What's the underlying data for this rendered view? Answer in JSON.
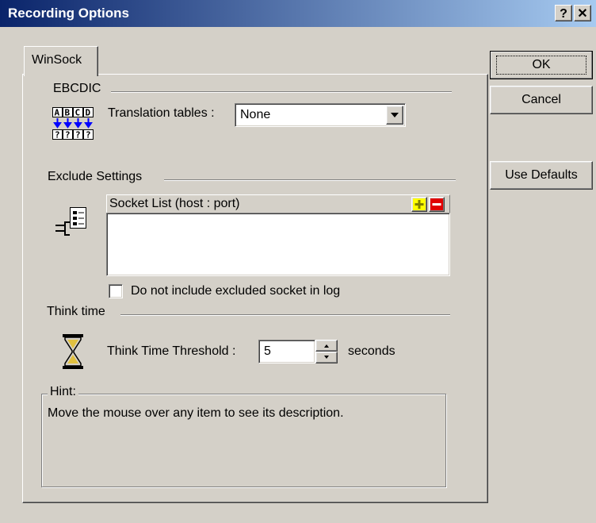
{
  "dialog": {
    "title": "Recording Options",
    "help_button": "?",
    "close_button": "✕"
  },
  "tabs": [
    {
      "label": "WinSock",
      "active": true
    }
  ],
  "buttons": {
    "ok": "OK",
    "cancel": "Cancel",
    "use_defaults": "Use Defaults"
  },
  "ebcdic": {
    "heading": "EBCDIC",
    "icon_top": "ABCD",
    "icon_bottom": "????",
    "translation_label": "Translation tables :",
    "translation_value": "None"
  },
  "exclude": {
    "heading": "Exclude Settings",
    "socket_list_header": "Socket List (host : port)",
    "add_glyph": "+",
    "remove_glyph": "−",
    "socket_items": [],
    "checkbox_label": "Do not include excluded socket in log",
    "checkbox_checked": false
  },
  "think_time": {
    "heading": "Think time",
    "threshold_label": "Think Time Threshold :",
    "threshold_value": "5",
    "units": "seconds"
  },
  "hint": {
    "label": "Hint:",
    "text": "Move the mouse over any item to see its description."
  },
  "icons": {
    "ebcdic": "ebcdic-translation-icon",
    "socket": "socket-plug-icon",
    "think": "hourglass-icon",
    "add": "plus-icon",
    "remove": "minus-icon",
    "dropdown": "chevron-down-icon",
    "spin_up": "spin-up-icon",
    "spin_down": "spin-down-icon"
  },
  "colors": {
    "titlebar_start": "#0a246a",
    "titlebar_end": "#a6caf0",
    "face": "#d4d0c8",
    "add_yellow": "#ffff00",
    "remove_red": "#e00000",
    "arrow_blue": "#0000ff"
  }
}
